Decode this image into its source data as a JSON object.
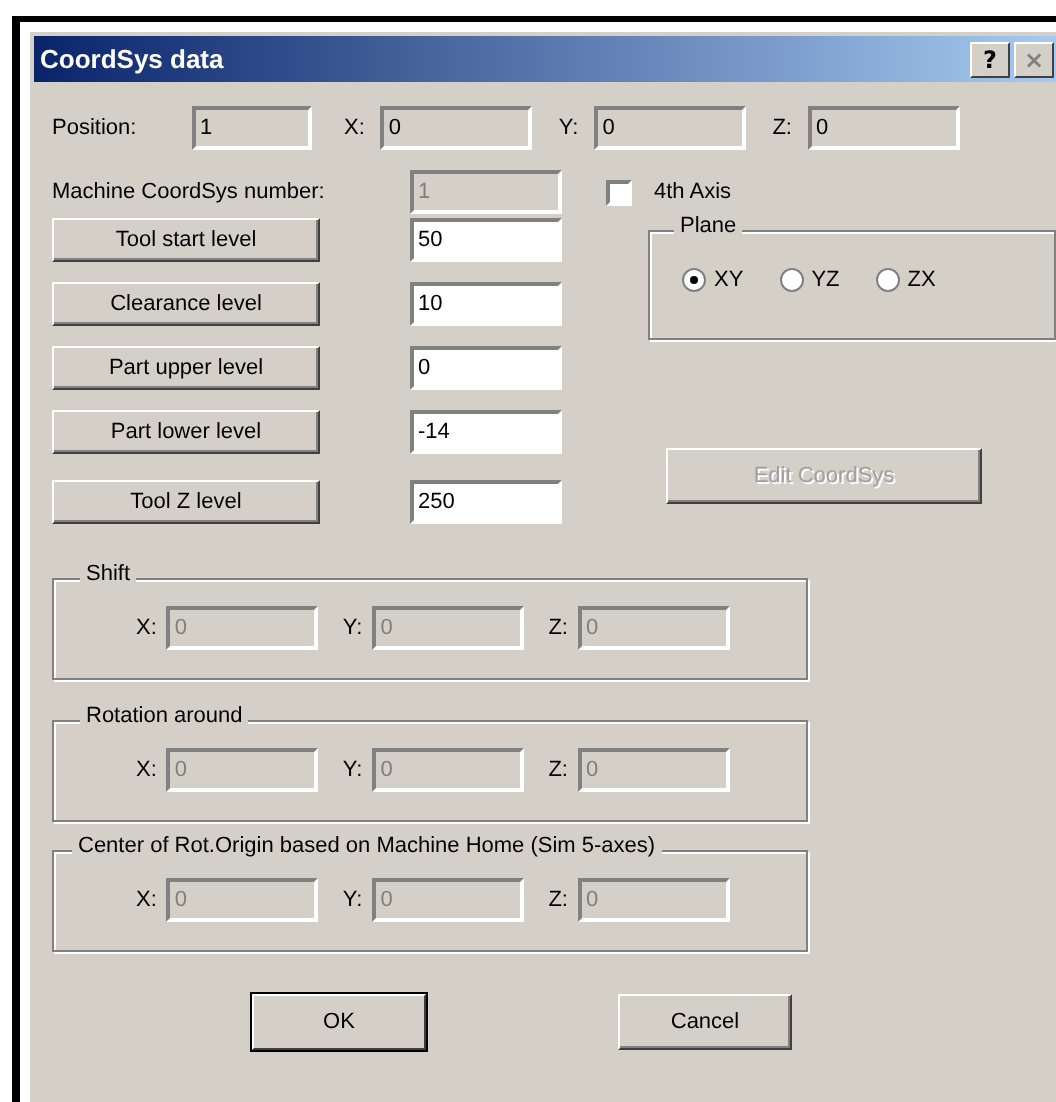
{
  "window": {
    "title": "CoordSys data",
    "title_buttons": [
      "?",
      "×"
    ]
  },
  "position": {
    "label": "Position:",
    "value": "1",
    "coords": [
      {
        "label": "X:",
        "value": "0"
      },
      {
        "label": "Y:",
        "value": "0"
      },
      {
        "label": "Z:",
        "value": "0"
      }
    ]
  },
  "machine_coordsys": {
    "label": "Machine CoordSys number:",
    "value": "1",
    "disabled": true
  },
  "fourth_axis": {
    "label": "4th Axis",
    "checked": false
  },
  "levels": [
    {
      "button": "Tool start level",
      "value": "50"
    },
    {
      "button": "Clearance level",
      "value": "10"
    },
    {
      "button": "Part upper level",
      "value": "0"
    },
    {
      "button": "Part lower level",
      "value": "-14"
    },
    {
      "button": "Tool  Z level",
      "value": "250"
    }
  ],
  "plane": {
    "title": "Plane",
    "options": [
      {
        "label": "XY",
        "selected": true
      },
      {
        "label": "YZ",
        "selected": false
      },
      {
        "label": "ZX",
        "selected": false
      }
    ]
  },
  "edit_coordsys": {
    "label": "Edit CoordSys",
    "disabled": true
  },
  "groups": [
    {
      "title": "Shift",
      "disabled": true,
      "fields": [
        {
          "label": "X:",
          "value": "0"
        },
        {
          "label": "Y:",
          "value": "0"
        },
        {
          "label": "Z:",
          "value": "0"
        }
      ]
    },
    {
      "title": "Rotation around",
      "disabled": true,
      "fields": [
        {
          "label": "X:",
          "value": "0"
        },
        {
          "label": "Y:",
          "value": "0"
        },
        {
          "label": "Z:",
          "value": "0"
        }
      ]
    },
    {
      "title": "Center of Rot.Origin based on Machine Home (Sim 5-axes)",
      "disabled": true,
      "fields": [
        {
          "label": "X:",
          "value": "0"
        },
        {
          "label": "Y:",
          "value": "0"
        },
        {
          "label": "Z:",
          "value": "0"
        }
      ]
    }
  ],
  "buttons": [
    {
      "label": "OK",
      "default": true
    },
    {
      "label": "Cancel",
      "default": false
    }
  ]
}
